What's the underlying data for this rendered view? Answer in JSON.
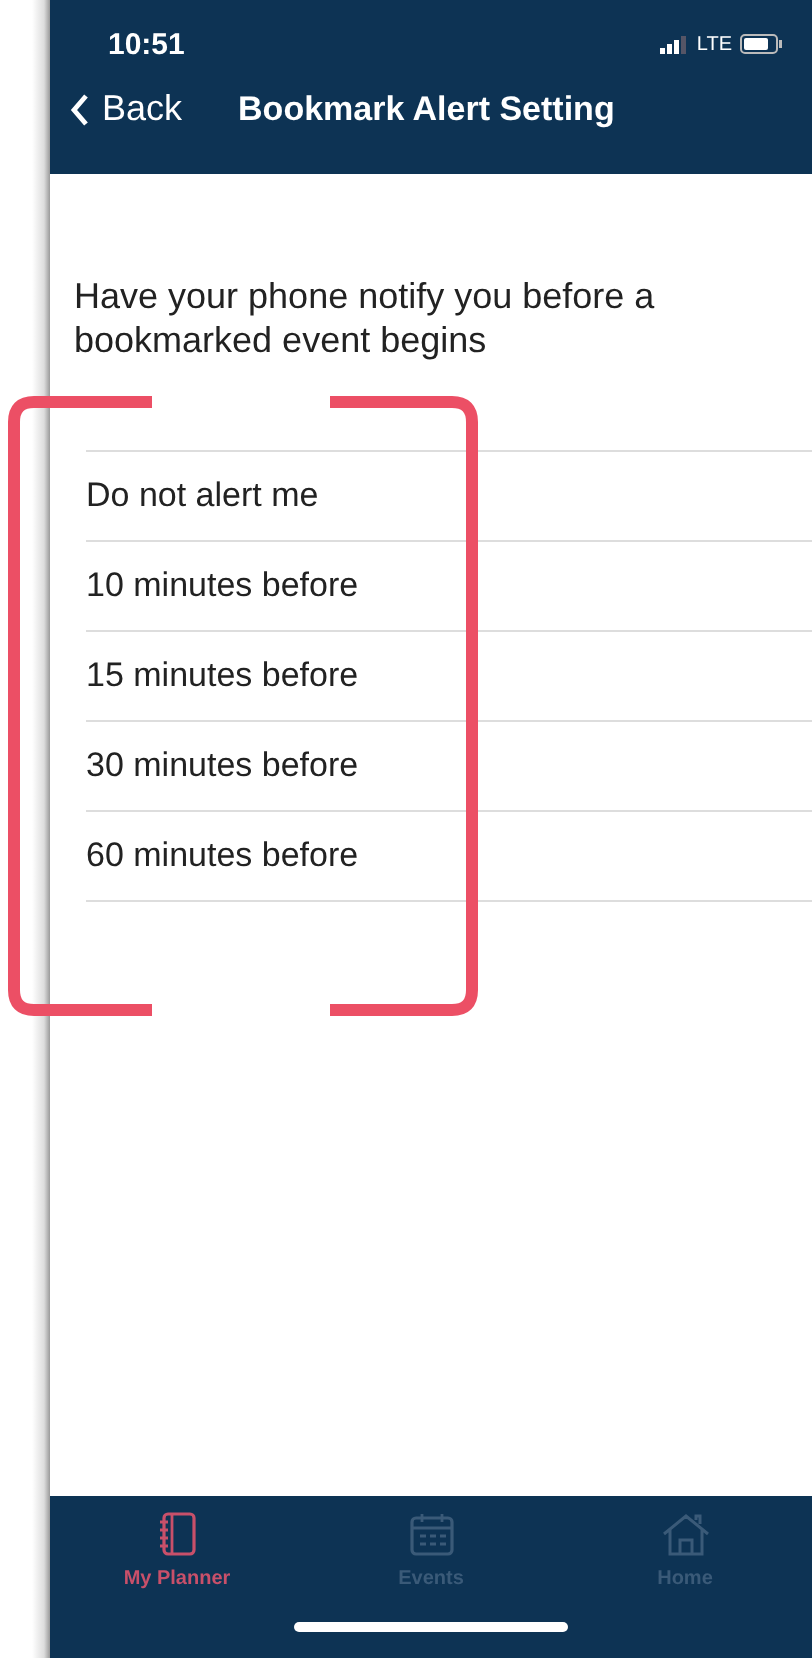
{
  "status_bar": {
    "time": "10:51",
    "network": "LTE"
  },
  "nav": {
    "back": "Back",
    "title": "Bookmark Alert Setting"
  },
  "intro": "Have your phone notify you before a bookmarked event begins",
  "options": [
    {
      "label": "Do not alert me"
    },
    {
      "label": "10 minutes before"
    },
    {
      "label": "15 minutes before"
    },
    {
      "label": "30 minutes before"
    },
    {
      "label": "60 minutes before"
    }
  ],
  "tab_bar": [
    {
      "label": "My Planner",
      "kind": "notebook",
      "selected": true
    },
    {
      "label": "Events",
      "kind": "calendar",
      "selected": false
    },
    {
      "label": "Home",
      "kind": "house",
      "selected": false
    }
  ]
}
